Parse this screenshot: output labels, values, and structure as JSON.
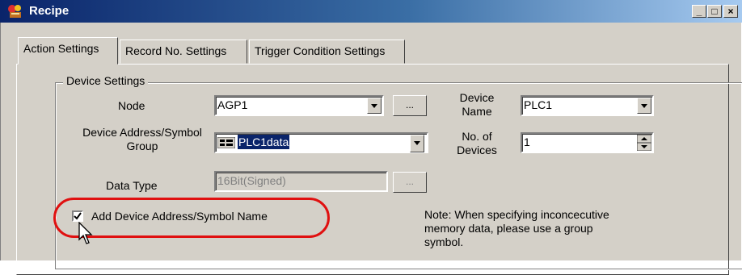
{
  "window": {
    "title": "Recipe",
    "min_label": "_",
    "max_label": "□",
    "close_label": "×"
  },
  "tabs": [
    {
      "label": "Action Settings",
      "active": true
    },
    {
      "label": "Record No. Settings",
      "active": false
    },
    {
      "label": "Trigger Condition Settings",
      "active": false
    }
  ],
  "device_settings": {
    "group_label": "Device Settings",
    "node": {
      "label": "Node",
      "value": "AGP1",
      "browse_label": "..."
    },
    "device_name": {
      "label_line1": "Device",
      "label_line2": "Name",
      "value": "PLC1"
    },
    "address_group": {
      "label_line1": "Device Address/Symbol",
      "label_line2": "Group",
      "value": "PLC1data"
    },
    "num_devices": {
      "label_line1": "No. of",
      "label_line2": "Devices",
      "value": "1"
    },
    "data_type": {
      "label": "Data Type",
      "value": "16Bit(Signed)",
      "browse_label": "..."
    },
    "add_name": {
      "label": "Add Device Address/Symbol Name",
      "checked": true
    },
    "note": {
      "line1": "Note: When specifying inconcecutive",
      "line2": "memory data, please use a group",
      "line3": "symbol."
    }
  },
  "colors": {
    "highlight": "#e01010",
    "title_bar": "#0a246a",
    "selection": "#0a246a"
  }
}
